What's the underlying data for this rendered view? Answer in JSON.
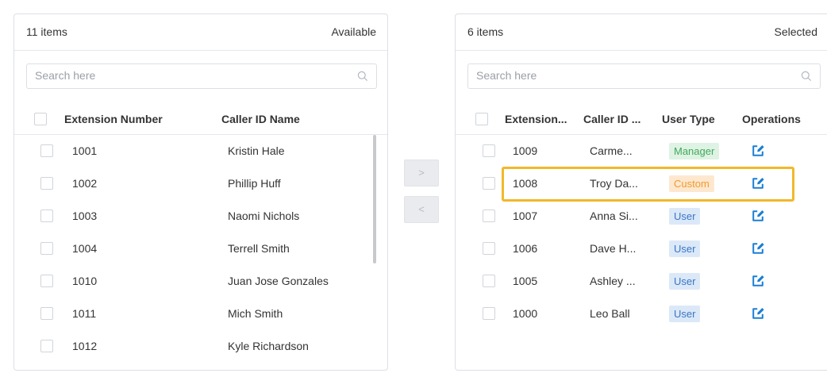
{
  "left_panel": {
    "count": "11 items",
    "title": "Available",
    "search_placeholder": "Search here",
    "columns": {
      "extension": "Extension Number",
      "caller_id": "Caller ID Name"
    },
    "rows": [
      {
        "extension": "1001",
        "name": "Kristin Hale"
      },
      {
        "extension": "1002",
        "name": "Phillip Huff"
      },
      {
        "extension": "1003",
        "name": "Naomi Nichols"
      },
      {
        "extension": "1004",
        "name": "Terrell Smith"
      },
      {
        "extension": "1010",
        "name": "Juan Jose Gonzales"
      },
      {
        "extension": "1011",
        "name": "Mich Smith"
      },
      {
        "extension": "1012",
        "name": "Kyle Richardson"
      }
    ]
  },
  "transfer": {
    "move_right": ">",
    "move_left": "<"
  },
  "right_panel": {
    "count": "6 items",
    "title": "Selected",
    "search_placeholder": "Search here",
    "columns": {
      "extension": "Extension...",
      "caller_id": "Caller ID ...",
      "user_type": "User Type",
      "operations": "Operations"
    },
    "rows": [
      {
        "extension": "1009",
        "name": "Carme...",
        "user_type": "Manager",
        "badge": "manager"
      },
      {
        "extension": "1008",
        "name": "Troy Da...",
        "user_type": "Custom",
        "badge": "custom"
      },
      {
        "extension": "1007",
        "name": "Anna Si...",
        "user_type": "User",
        "badge": "user"
      },
      {
        "extension": "1006",
        "name": "Dave H...",
        "user_type": "User",
        "badge": "user"
      },
      {
        "extension": "1005",
        "name": "Ashley ...",
        "user_type": "User",
        "badge": "user"
      },
      {
        "extension": "1000",
        "name": "Leo Ball",
        "user_type": "User",
        "badge": "user"
      }
    ]
  },
  "colors": {
    "accent": "#1a7fd4",
    "highlight": "#f2b82a",
    "manager_badge": "#43a85d",
    "custom_badge": "#f29a2e",
    "user_badge": "#3a76c4"
  },
  "icons": {
    "search": "search-icon",
    "edit": "edit-icon"
  }
}
